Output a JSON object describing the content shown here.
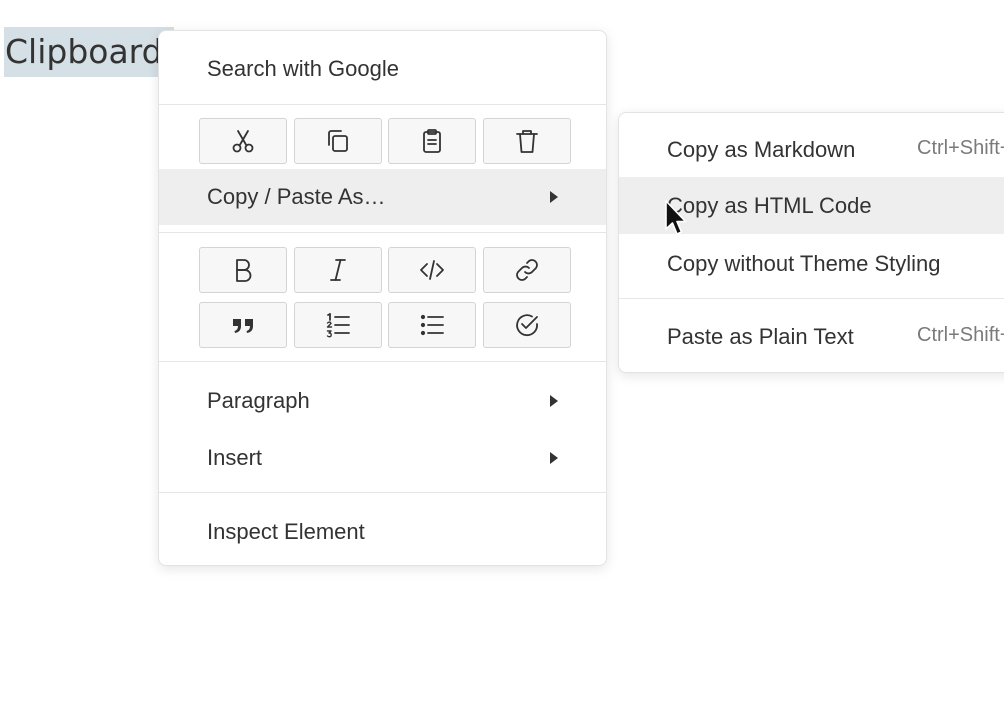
{
  "document": {
    "selected_text": "Clipboard"
  },
  "context_menu": {
    "search_label": "Search with Google",
    "toolbar_clipboard": [
      {
        "icon": "scissors-icon",
        "name": "cut-button"
      },
      {
        "icon": "copy-icon",
        "name": "copy-button"
      },
      {
        "icon": "clipboard-icon",
        "name": "paste-button"
      },
      {
        "icon": "trash-icon",
        "name": "delete-button"
      }
    ],
    "copy_paste_as_label": "Copy / Paste As…",
    "toolbar_format": [
      {
        "icon": "bold-icon",
        "name": "bold-button"
      },
      {
        "icon": "italic-icon",
        "name": "italic-button"
      },
      {
        "icon": "code-icon",
        "name": "code-button"
      },
      {
        "icon": "link-icon",
        "name": "link-button"
      },
      {
        "icon": "quote-icon",
        "name": "quote-button"
      },
      {
        "icon": "ordered-list-icon",
        "name": "ordered-list-button"
      },
      {
        "icon": "bullet-list-icon",
        "name": "bullet-list-button"
      },
      {
        "icon": "task-list-icon",
        "name": "task-list-button"
      }
    ],
    "paragraph_label": "Paragraph",
    "insert_label": "Insert",
    "inspect_label": "Inspect Element"
  },
  "submenu": {
    "copy_markdown_label": "Copy as Markdown",
    "copy_markdown_shortcut": "Ctrl+Shift+C",
    "copy_html_label": "Copy as HTML Code",
    "copy_no_theme_label": "Copy without Theme Styling",
    "paste_plain_label": "Paste as Plain Text",
    "paste_plain_shortcut": "Ctrl+Shift+V"
  },
  "colors": {
    "selection_highlight": "#d5dfe6",
    "active_item_bg": "#eeeeee",
    "menu_border": "#e3e3e3"
  }
}
